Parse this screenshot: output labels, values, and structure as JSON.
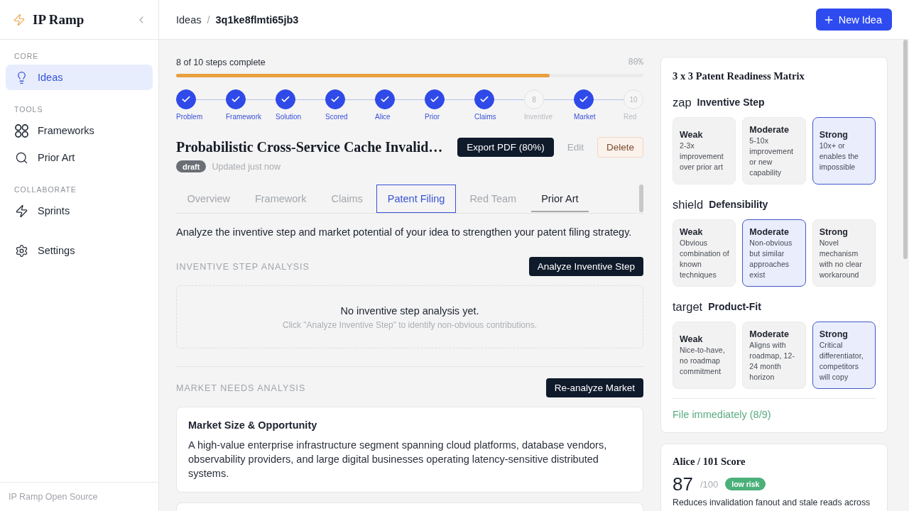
{
  "sidebar": {
    "brand": "IP Ramp",
    "sections": [
      {
        "heading": "CORE",
        "items": [
          {
            "label": "Ideas",
            "selected": true
          }
        ]
      },
      {
        "heading": "TOOLS",
        "items": [
          {
            "label": "Frameworks",
            "selected": false
          },
          {
            "label": "Prior Art",
            "selected": false
          }
        ]
      },
      {
        "heading": "COLLABORATE",
        "items": [
          {
            "label": "Sprints",
            "selected": false
          }
        ]
      },
      {
        "items": [
          {
            "label": "Settings",
            "selected": false
          }
        ]
      }
    ],
    "footer": "IP Ramp Open Source"
  },
  "topbar": {
    "breadcrumb": [
      "Ideas",
      "3q1ke8flmti65jb3"
    ],
    "separator": "/",
    "new_button": "New Idea"
  },
  "progress": {
    "label": "8 of 10 steps complete",
    "percent": "80%",
    "level": 0.8
  },
  "steps": [
    {
      "label": "Problem",
      "complete": true
    },
    {
      "label": "Framework",
      "complete": true
    },
    {
      "label": "Solution",
      "complete": true
    },
    {
      "label": "Scored",
      "complete": true
    },
    {
      "label": "Alice",
      "complete": true
    },
    {
      "label": "Prior",
      "complete": true
    },
    {
      "label": "Claims",
      "complete": true
    },
    {
      "number": "8",
      "label": "Inventive",
      "complete": false
    },
    {
      "label": "Market",
      "complete": true
    },
    {
      "number": "10",
      "label": "Red",
      "complete": false
    }
  ],
  "idea": {
    "title": "Probabilistic Cross-Service Cache Invalid…",
    "status": "draft",
    "updated": "Updated just now",
    "actions": [
      {
        "label": "Export PDF (80%)",
        "kind": "primary"
      },
      {
        "label": "Edit",
        "kind": "ghost"
      },
      {
        "label": "Delete",
        "kind": "danger"
      }
    ]
  },
  "tabs": [
    {
      "label": "Overview",
      "selected": false,
      "underlined": false
    },
    {
      "label": "Framework",
      "selected": false,
      "underlined": false
    },
    {
      "label": "Claims",
      "selected": false,
      "underlined": false
    },
    {
      "label": "Patent Filing",
      "selected": true,
      "underlined": false
    },
    {
      "label": "Red Team",
      "selected": false,
      "underlined": false
    },
    {
      "label": "Prior Art",
      "selected": false,
      "underlined": true
    }
  ],
  "patent_filing": {
    "intro": "Analyze the inventive step and market potential of your idea to strengthen your patent filing strategy.",
    "inventive_step": {
      "heading": "INVENTIVE STEP ANALYSIS",
      "button": "Analyze Inventive Step",
      "empty_title": "No inventive step analysis yet.",
      "empty_hint": "Click \"Analyze Inventive Step\" to identify non-obvious contributions."
    },
    "market_needs": {
      "heading": "MARKET NEEDS ANALYSIS",
      "button": "Re-analyze Market",
      "cards": [
        {
          "title": "Market Size & Opportunity",
          "body": "A high-value enterprise infrastructure segment spanning cloud platforms, database vendors, observability providers, and large digital businesses operating latency-sensitive distributed systems."
        }
      ]
    }
  },
  "matrix": {
    "title": "3 x 3 Patent Readiness Matrix",
    "criteria": [
      {
        "icon_text": "zap",
        "name": "Inventive Step",
        "levels": [
          {
            "name": "Weak",
            "description": "2-3x improvement over prior art",
            "selected": false
          },
          {
            "name": "Moderate",
            "description": "5-10x improvement or new capability",
            "selected": false
          },
          {
            "name": "Strong",
            "description": "10x+ or enables the impossible",
            "selected": true
          }
        ]
      },
      {
        "icon_text": "shield",
        "name": "Defensibility",
        "levels": [
          {
            "name": "Weak",
            "description": "Obvious combination of known techniques",
            "selected": false
          },
          {
            "name": "Moderate",
            "description": "Non-obvious but similar approaches exist",
            "selected": true
          },
          {
            "name": "Strong",
            "description": "Novel mechanism with no clear workaround",
            "selected": false
          }
        ]
      },
      {
        "icon_text": "target",
        "name": "Product-Fit",
        "levels": [
          {
            "name": "Weak",
            "description": "Nice-to-have, no roadmap commitment",
            "selected": false
          },
          {
            "name": "Moderate",
            "description": "Aligns with roadmap, 12-24 month horizon",
            "selected": false
          },
          {
            "name": "Strong",
            "description": "Critical differentiator, competitors will copy",
            "selected": true
          }
        ]
      }
    ],
    "verdict": "File immediately (8/9)"
  },
  "alice": {
    "title": "Alice / 101 Score",
    "score": "87",
    "max": "/100",
    "risk": "low risk",
    "summary": "Reduces invalidation fanout and stale reads across"
  }
}
